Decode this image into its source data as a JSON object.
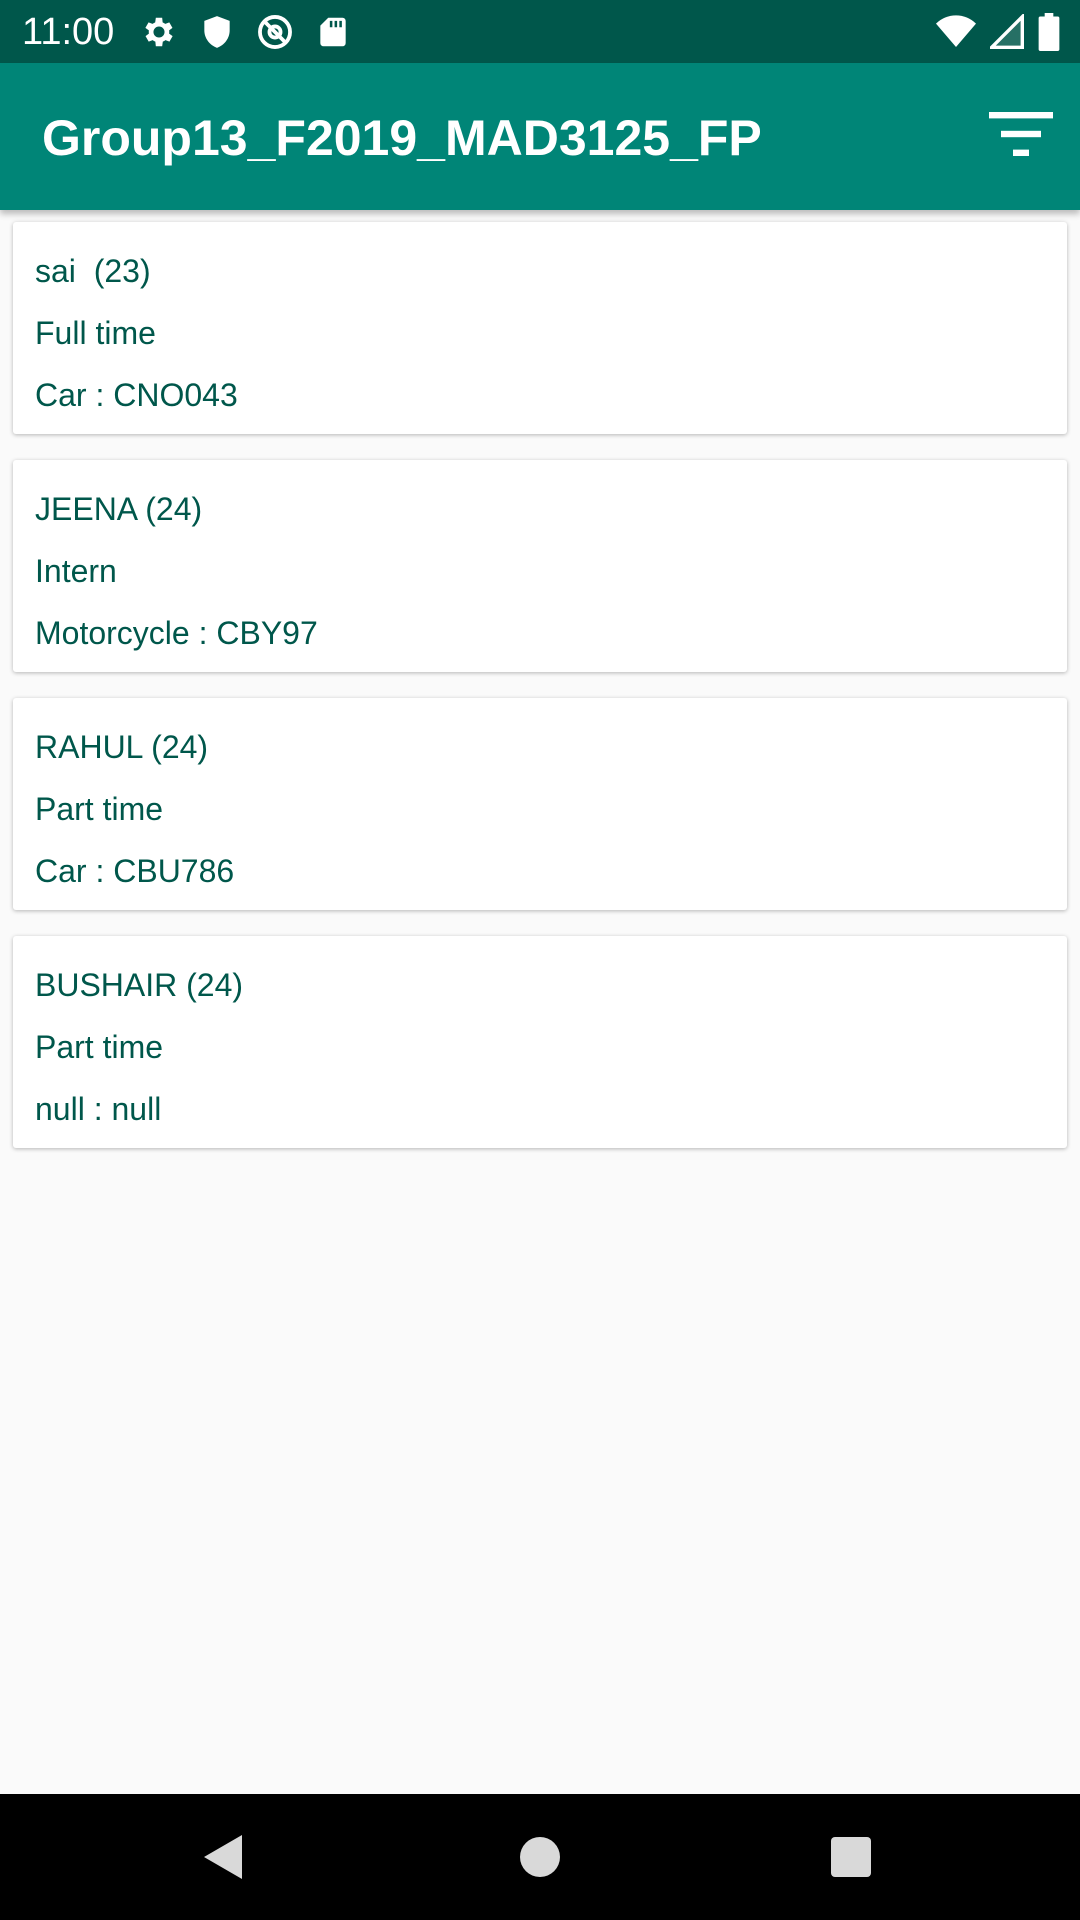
{
  "status_bar": {
    "time": "11:00",
    "left_icons": [
      "settings-icon",
      "shield-icon",
      "at-sign-icon",
      "sd-card-icon"
    ],
    "right_icons": [
      "wifi-icon",
      "signal-icon",
      "battery-icon"
    ]
  },
  "app_bar": {
    "title": "Group13_F2019_MAD3125_FP",
    "filter_icon": "filter-icon"
  },
  "employees": [
    {
      "name_age": "sai  (23)",
      "type": "Full time",
      "vehicle": "Car : CNO043"
    },
    {
      "name_age": "JEENA (24)",
      "type": "Intern",
      "vehicle": "Motorcycle : CBY97"
    },
    {
      "name_age": "RAHUL (24)",
      "type": "Part time",
      "vehicle": "Car : CBU786"
    },
    {
      "name_age": "BUSHAIR (24)",
      "type": "Part time",
      "vehicle": "null : null"
    }
  ],
  "nav_bar": {
    "icons": [
      "back-icon",
      "home-icon",
      "recents-icon"
    ]
  },
  "colors": {
    "status_bar": "#00574b",
    "app_bar": "#008577",
    "text": "#00574b",
    "background": "#fafafa"
  }
}
